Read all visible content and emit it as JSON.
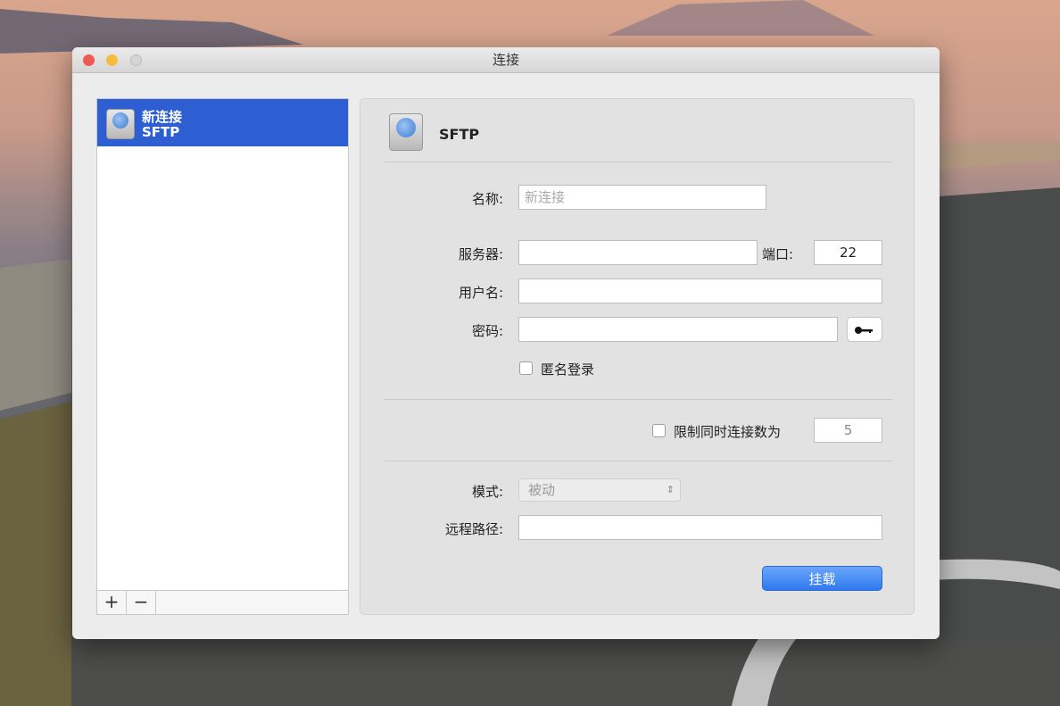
{
  "window": {
    "title": "连接"
  },
  "sidebar": {
    "items": [
      {
        "name": "新连接",
        "protocol": "SFTP",
        "icon": "network-drive-icon"
      }
    ],
    "add_label": "+",
    "remove_label": "−"
  },
  "panel": {
    "protocol_title": "SFTP",
    "name_label": "名称:",
    "name_placeholder": "新连接",
    "name_value": "",
    "server_label": "服务器:",
    "server_value": "",
    "port_label": "端口:",
    "port_value": "22",
    "username_label": "用户名:",
    "username_value": "",
    "password_label": "密码:",
    "password_value": "",
    "anonymous_label": "匿名登录",
    "anonymous_checked": false,
    "limit_label": "限制同时连接数为",
    "limit_checked": false,
    "limit_value": "5",
    "mode_label": "模式:",
    "mode_value": "被动",
    "remote_path_label": "远程路径:",
    "remote_path_value": "",
    "mount_label": "挂载"
  },
  "colors": {
    "accent": "#2d5fd3",
    "button": "#3b82f0"
  }
}
